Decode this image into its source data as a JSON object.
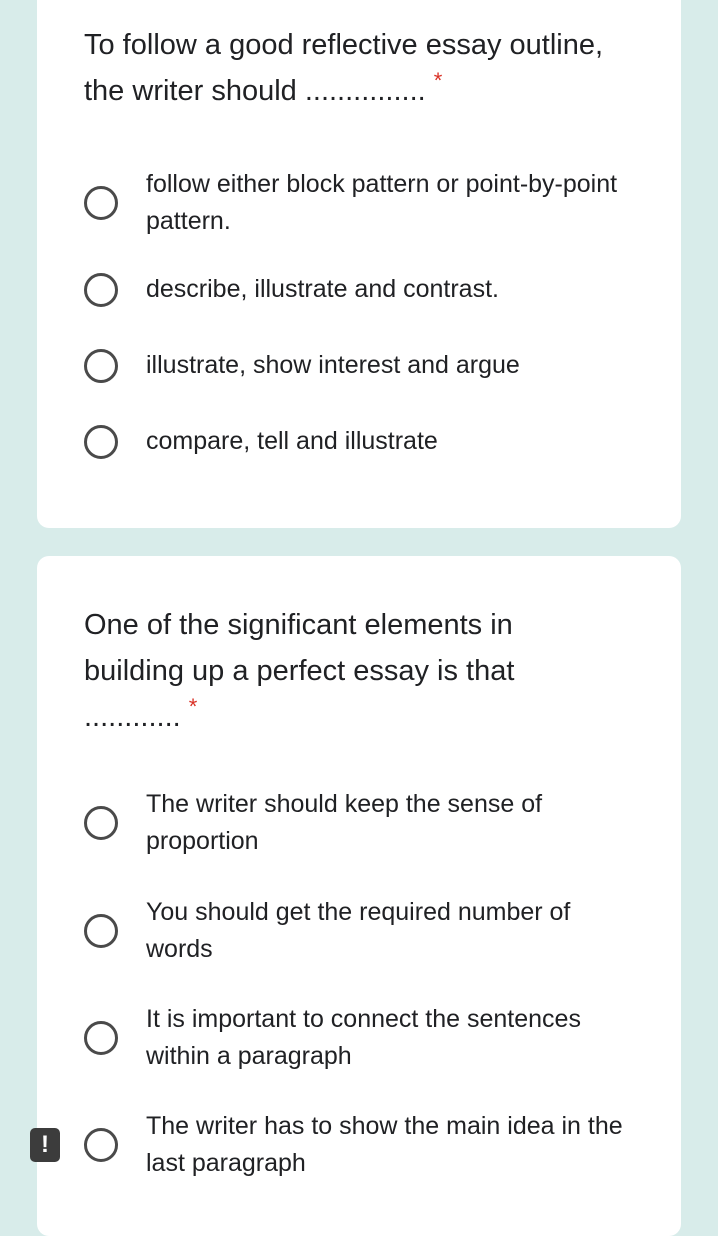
{
  "q1": {
    "text": "To follow a good reflective essay outline, the writer should ...............",
    "required_mark": "*",
    "options": [
      {
        "label": "follow either block pattern or point-by-point pattern."
      },
      {
        "label": "describe, illustrate and contrast."
      },
      {
        "label": "illustrate, show interest and argue"
      },
      {
        "label": "compare, tell and illustrate"
      }
    ]
  },
  "q2": {
    "text": "One of the significant elements in building up a perfect essay is that ............",
    "required_mark": "*",
    "options": [
      {
        "label": "The writer should keep the sense of proportion"
      },
      {
        "label": "You should get the required number of words"
      },
      {
        "label": "It is important to connect the sentences within a paragraph"
      },
      {
        "label": "The writer has to show the main idea in the last paragraph"
      }
    ]
  },
  "alert_badge": {
    "symbol": "!"
  },
  "colors": {
    "background": "#d8ecea",
    "card": "#ffffff",
    "required": "#d93025",
    "text": "#202124"
  }
}
